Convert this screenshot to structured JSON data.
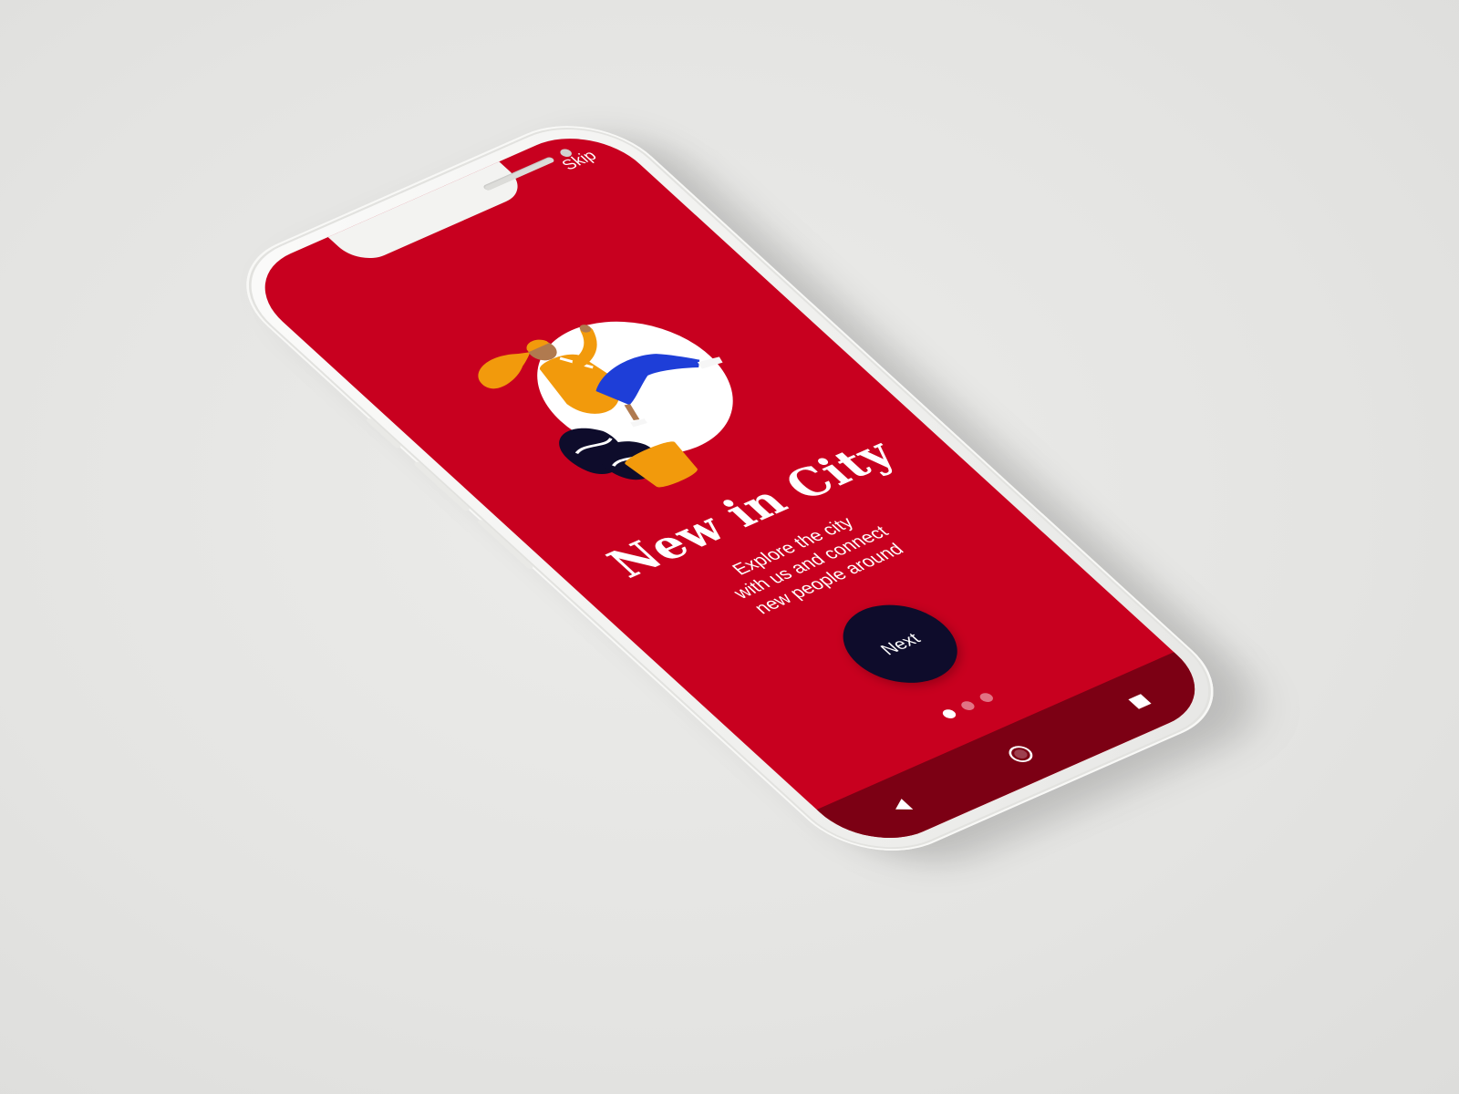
{
  "onboarding": {
    "skip_label": "Skip",
    "title": "New in City",
    "subtitle_lines": [
      "Explore the city",
      "with us and connect",
      "new people around"
    ],
    "next_label": "Next",
    "page_indicator": {
      "total": 3,
      "current": 1
    }
  },
  "navbar": {
    "back_icon": "back-triangle-icon",
    "home_icon": "home-circle-icon",
    "recents_icon": "recents-square-icon"
  },
  "colors": {
    "screen_bg": "#c8001f",
    "navbar_bg": "#7c0014",
    "button_bg": "#0e0c2b",
    "illustration_orange": "#f29a0c",
    "illustration_blue": "#1e3ed8",
    "illustration_navy": "#0e0c2b"
  }
}
